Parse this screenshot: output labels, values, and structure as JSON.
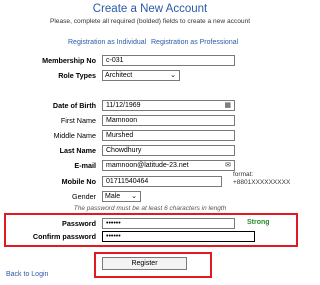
{
  "header": {
    "title": "Create a New Account",
    "subtitle": "Please, complete all required (bolded) fields to create a new account",
    "link_individual": "Registration as Individual",
    "link_professional": "Registration as Professional"
  },
  "form": {
    "membership_no": {
      "label": "Membership No",
      "value": "c-031"
    },
    "role_types": {
      "label": "Role Types",
      "value": "Architect"
    },
    "dob": {
      "label": "Date of Birth",
      "value": "11/12/1969"
    },
    "first_name": {
      "label": "First Name",
      "value": "Mamnoon"
    },
    "middle_name": {
      "label": "Middle Name",
      "value": "Murshed"
    },
    "last_name": {
      "label": "Last Name",
      "value": "Chowdhury"
    },
    "email": {
      "label": "E-mail",
      "value": "mamnoon@latitude-23.net"
    },
    "mobile": {
      "label": "Mobile No",
      "value": "01711540464",
      "hint_line1": "format:",
      "hint_line2": "+8801XXXXXXXXX"
    },
    "gender": {
      "label": "Gender",
      "value": "Male"
    },
    "password_hint": "The password must be at least 6 characters in length",
    "password": {
      "label": "Password",
      "value": "••••••",
      "strength": "Strong"
    },
    "confirm_password": {
      "label": "Confirm password",
      "value": "••••••"
    }
  },
  "actions": {
    "register_label": "Register",
    "back_label": "Back to Login"
  },
  "colors": {
    "link": "#2a5aa8",
    "highlight": "#e01a22",
    "strong": "#2a8a2a"
  },
  "icons": {
    "calendar": "calendar-icon",
    "email": "envelope-icon",
    "dropdown": "chevron-down-icon"
  }
}
